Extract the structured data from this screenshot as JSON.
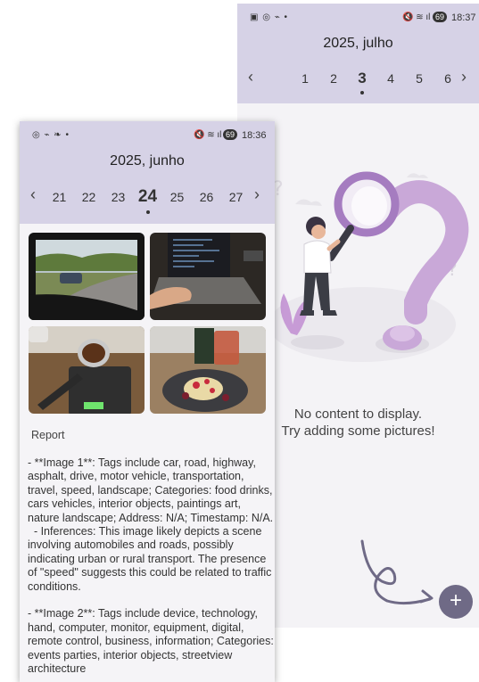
{
  "back_screen": {
    "status": {
      "time": "18:37",
      "battery": "69"
    },
    "month_title": "2025, julho",
    "days": [
      "1",
      "2",
      "3",
      "4",
      "5",
      "6"
    ],
    "selected_day": "3",
    "empty_state": {
      "line1": "No content to display.",
      "line2": "Try adding some pictures!"
    },
    "fab_label": "+"
  },
  "front_screen": {
    "status": {
      "time": "18:36",
      "battery": "69"
    },
    "month_title": "2025, junho",
    "days": [
      "21",
      "22",
      "23",
      "24",
      "25",
      "26",
      "27"
    ],
    "selected_day": "24",
    "photos": [
      {
        "subject": "car on rural road through window"
      },
      {
        "subject": "hand on laptop keyboard"
      },
      {
        "subject": "coffee grinder and scale"
      },
      {
        "subject": "plate of food with drinks"
      }
    ],
    "report": {
      "title": "Report",
      "body": "- **Image 1**: Tags include car, road, highway, asphalt, drive, motor vehicle, transportation, travel, speed, landscape; Categories: food drinks, cars vehicles, interior objects, paintings art, nature landscape; Address: N/A; Timestamp: N/A.\n  - Inferences: This image likely depicts a scene involving automobiles and roads, possibly indicating urban or rural transport. The presence of \"speed\" suggests this could be related to traffic conditions.\n\n- **Image 2**: Tags include device, technology, hand, computer, monitor, equipment, digital, remote control, business, information; Categories: events parties, interior objects, streetview architecture"
    }
  }
}
